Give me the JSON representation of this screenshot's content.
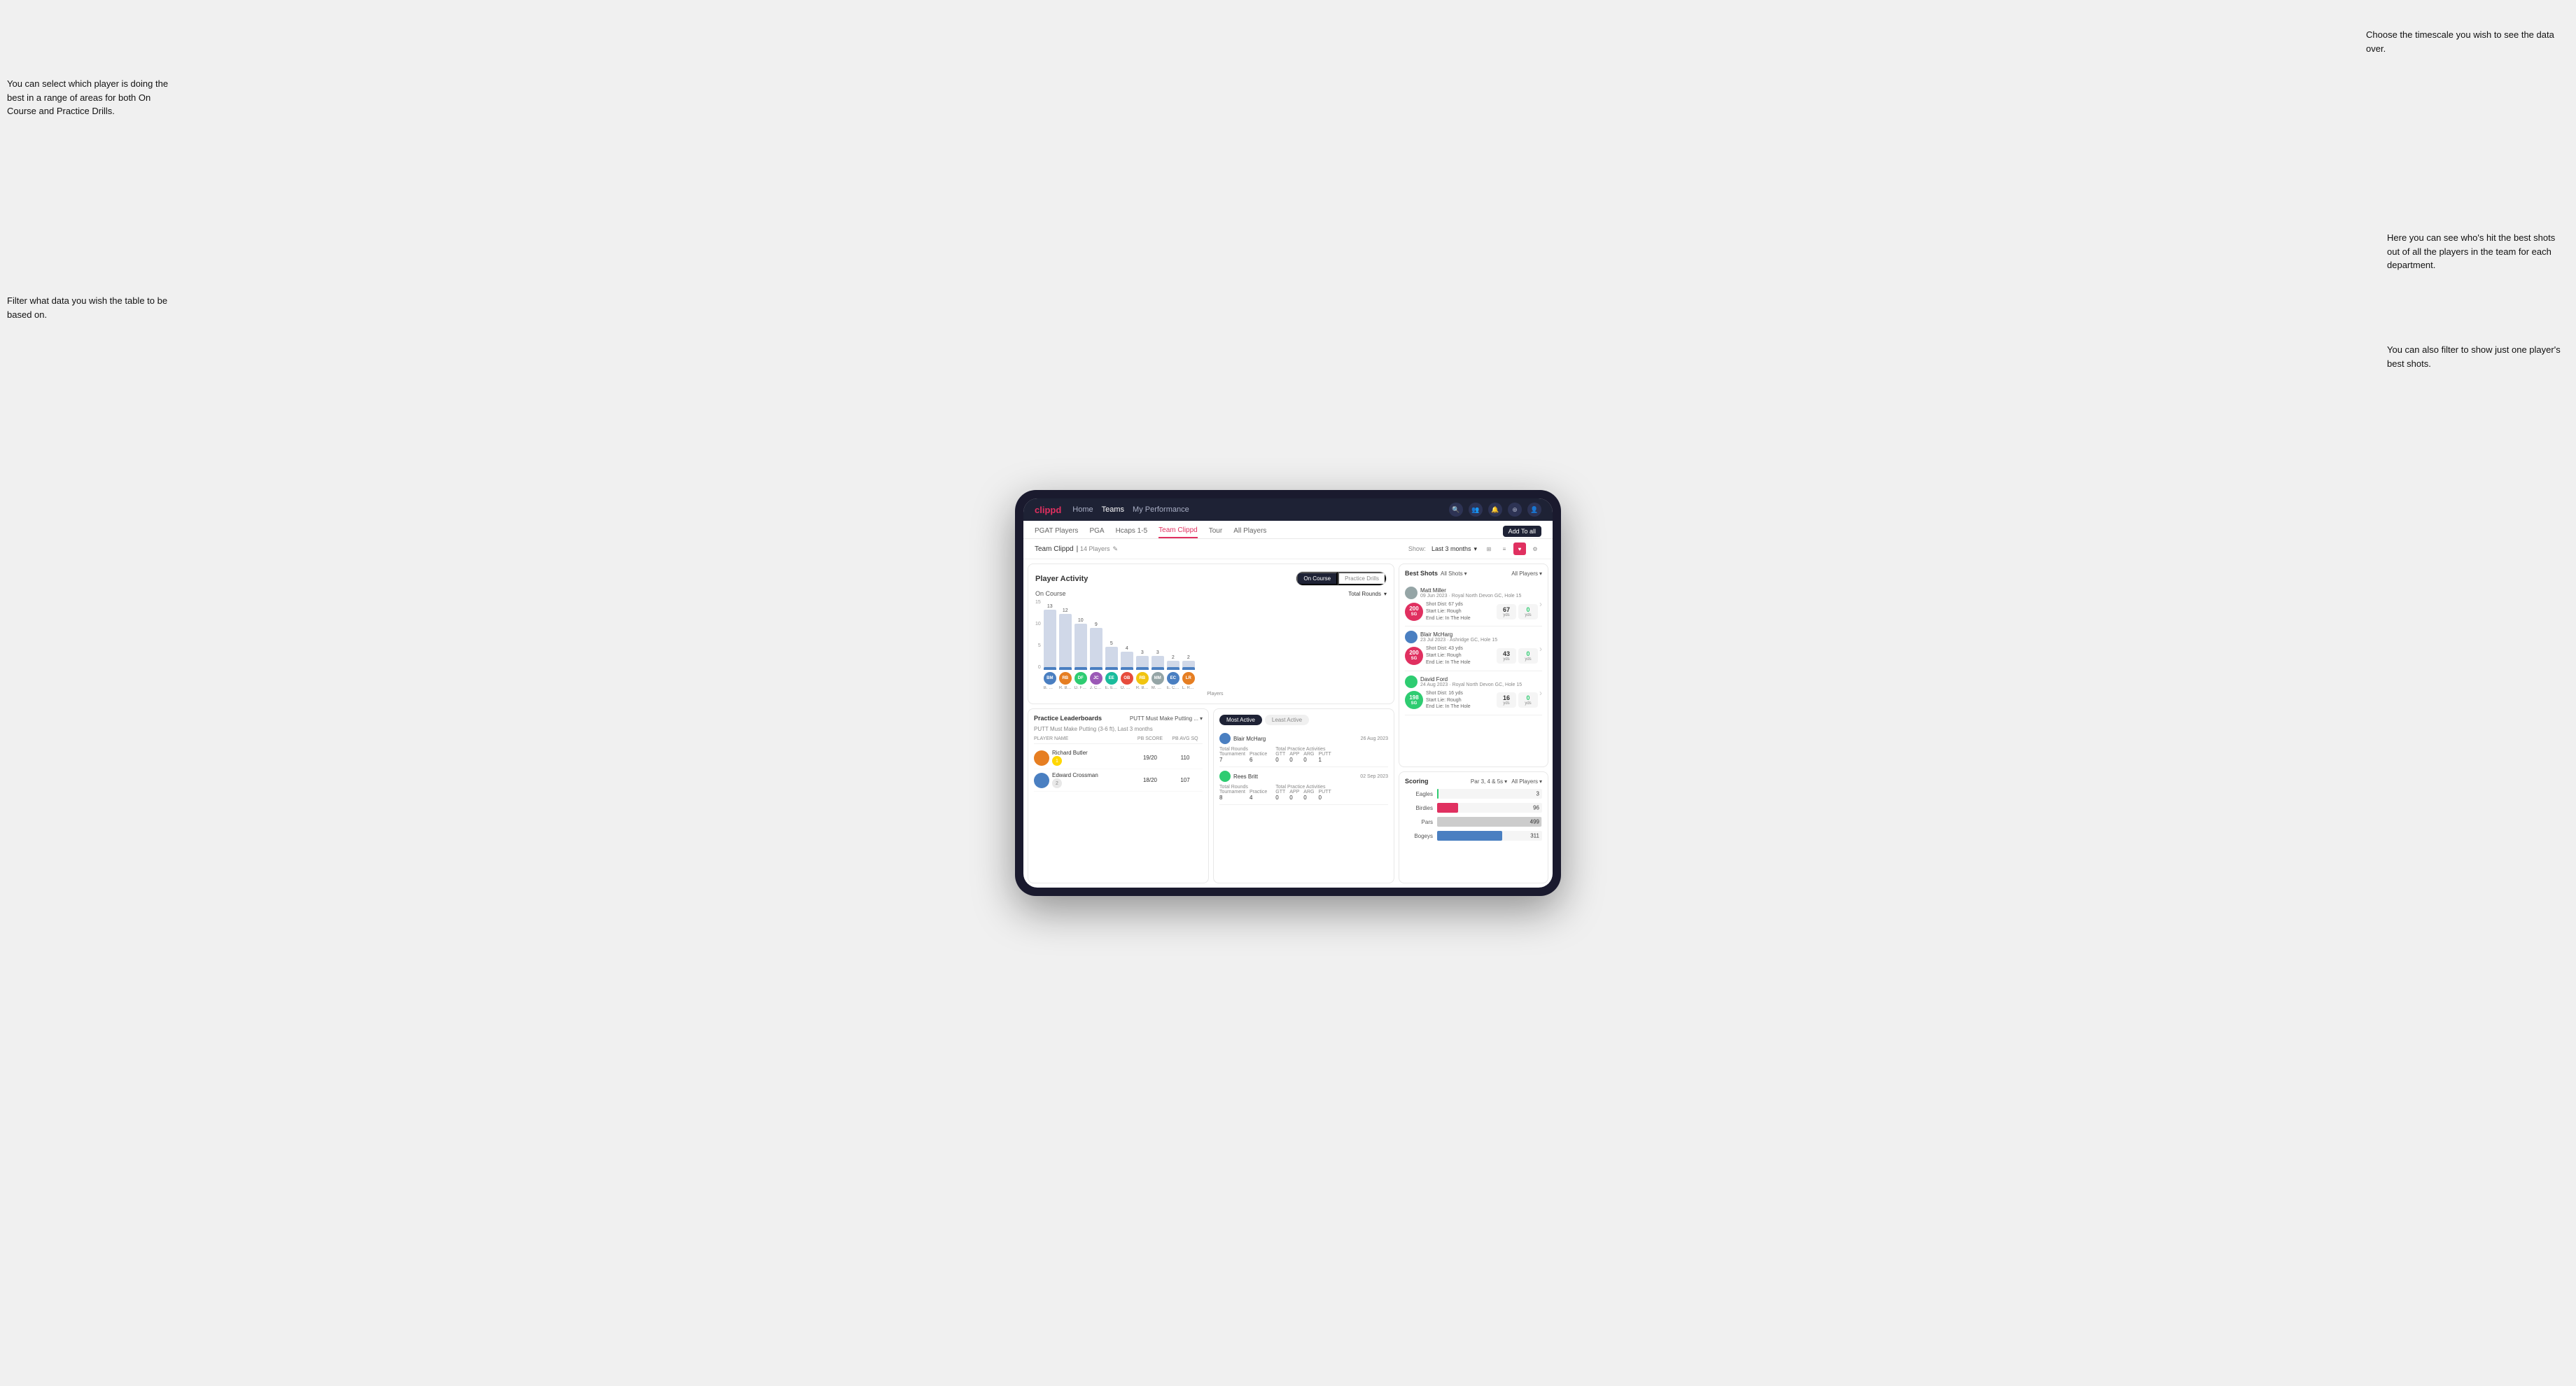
{
  "annotations": {
    "top_right": "Choose the timescale you wish to see the data over.",
    "left_top": "You can select which player is doing the best in a range of areas for both On Course and Practice Drills.",
    "left_bottom": "Filter what data you wish the table to be based on.",
    "right_middle": "Here you can see who's hit the best shots out of all the players in the team for each department.",
    "right_bottom": "You can also filter to show just one player's best shots."
  },
  "nav": {
    "logo": "clippd",
    "links": [
      "Home",
      "Teams",
      "My Performance"
    ],
    "sub_links": [
      "PGAT Players",
      "PGA",
      "Hcaps 1-5",
      "Team Clippd",
      "Tour",
      "All Players"
    ],
    "active_sub": "Team Clippd",
    "add_btn": "Add To all"
  },
  "team_header": {
    "title": "Team Clippd",
    "players": "14 Players",
    "show_label": "Show:",
    "show_value": "Last 3 months",
    "chevron": "▾"
  },
  "player_activity": {
    "title": "Player Activity",
    "toggle_oncourse": "On Course",
    "toggle_practice": "Practice Drills",
    "section_title": "On Course",
    "filter_label": "Total Rounds",
    "y_labels": [
      "15",
      "10",
      "5",
      "0"
    ],
    "bars": [
      {
        "name": "B. McHarg",
        "value": 13,
        "height": 86
      },
      {
        "name": "R. Britt",
        "value": 12,
        "height": 80
      },
      {
        "name": "D. Ford",
        "value": 10,
        "height": 66
      },
      {
        "name": "J. Coles",
        "value": 9,
        "height": 60
      },
      {
        "name": "E. Ebert",
        "value": 5,
        "height": 33
      },
      {
        "name": "O. Billingham",
        "value": 4,
        "height": 26
      },
      {
        "name": "R. Butler",
        "value": 3,
        "height": 20
      },
      {
        "name": "M. Miller",
        "value": 3,
        "height": 20
      },
      {
        "name": "E. Crossman",
        "value": 2,
        "height": 13
      },
      {
        "name": "L. Robertson",
        "value": 2,
        "height": 13
      }
    ],
    "x_label": "Players",
    "y_label": "Total Rounds"
  },
  "best_shots": {
    "title": "Best Shots",
    "filter1": "All Shots",
    "filter2": "All Players",
    "players": [
      {
        "name": "Matt Miller",
        "date": "09 Jun 2023",
        "course": "Royal North Devon GC",
        "hole": "Hole 15",
        "badge": "200",
        "badge_sub": "SG",
        "dist": "Shot Dist: 67 yds",
        "start": "Start Lie: Rough",
        "end": "End Lie: In The Hole",
        "metric1_val": "67",
        "metric1_unit": "yds",
        "metric2_val": "0",
        "metric2_unit": "yds"
      },
      {
        "name": "Blair McHarg",
        "date": "23 Jul 2023",
        "course": "Ashridge GC",
        "hole": "Hole 15",
        "badge": "200",
        "badge_sub": "SG",
        "dist": "Shot Dist: 43 yds",
        "start": "Start Lie: Rough",
        "end": "End Lie: In The Hole",
        "metric1_val": "43",
        "metric1_unit": "yds",
        "metric2_val": "0",
        "metric2_unit": "yds"
      },
      {
        "name": "David Ford",
        "date": "24 Aug 2023",
        "course": "Royal North Devon GC",
        "hole": "Hole 15",
        "badge": "198",
        "badge_sub": "SG",
        "dist": "Shot Dist: 16 yds",
        "start": "Start Lie: Rough",
        "end": "End Lie: In The Hole",
        "metric1_val": "16",
        "metric1_unit": "yds",
        "metric2_val": "0",
        "metric2_unit": "yds"
      }
    ]
  },
  "practice_leaderboards": {
    "title": "Practice Leaderboards",
    "filter": "PUTT Must Make Putting ...",
    "subtitle": "PUTT Must Make Putting (3-6 ft), Last 3 months",
    "col_name": "PLAYER NAME",
    "col_score": "PB SCORE",
    "col_avg": "PB AVG SQ",
    "players": [
      {
        "name": "Richard Butler",
        "rank": "1",
        "rank_type": "gold",
        "score": "19/20",
        "avg": "110"
      },
      {
        "name": "Edward Crossman",
        "rank": "2",
        "rank_type": "silver",
        "score": "18/20",
        "avg": "107"
      }
    ]
  },
  "activity": {
    "tab_most_active": "Most Active",
    "tab_least_active": "Least Active",
    "items": [
      {
        "name": "Blair McHarg",
        "date": "26 Aug 2023",
        "rounds_label": "Total Rounds",
        "tournament_label": "Tournament",
        "tournament": "7",
        "practice_label": "Practice",
        "practice": "6",
        "activities_label": "Total Practice Activities",
        "gtt": "0",
        "app": "0",
        "arg": "0",
        "putt": "1"
      },
      {
        "name": "Rees Britt",
        "date": "02 Sep 2023",
        "tournament": "8",
        "practice": "4",
        "gtt": "0",
        "app": "0",
        "arg": "0",
        "putt": "0"
      }
    ]
  },
  "scoring": {
    "title": "Scoring",
    "filter1": "Par 3, 4 & 5s",
    "filter2": "All Players",
    "rows": [
      {
        "label": "Eagles",
        "value": 3,
        "max": 500,
        "color": "#2ecc71"
      },
      {
        "label": "Birdies",
        "value": 96,
        "max": 500,
        "color": "#e03060"
      },
      {
        "label": "Pars",
        "value": 499,
        "max": 500,
        "color": "#ccc"
      },
      {
        "label": "Bogeys",
        "value": 311,
        "max": 500,
        "color": "#4a7fc1"
      }
    ]
  }
}
